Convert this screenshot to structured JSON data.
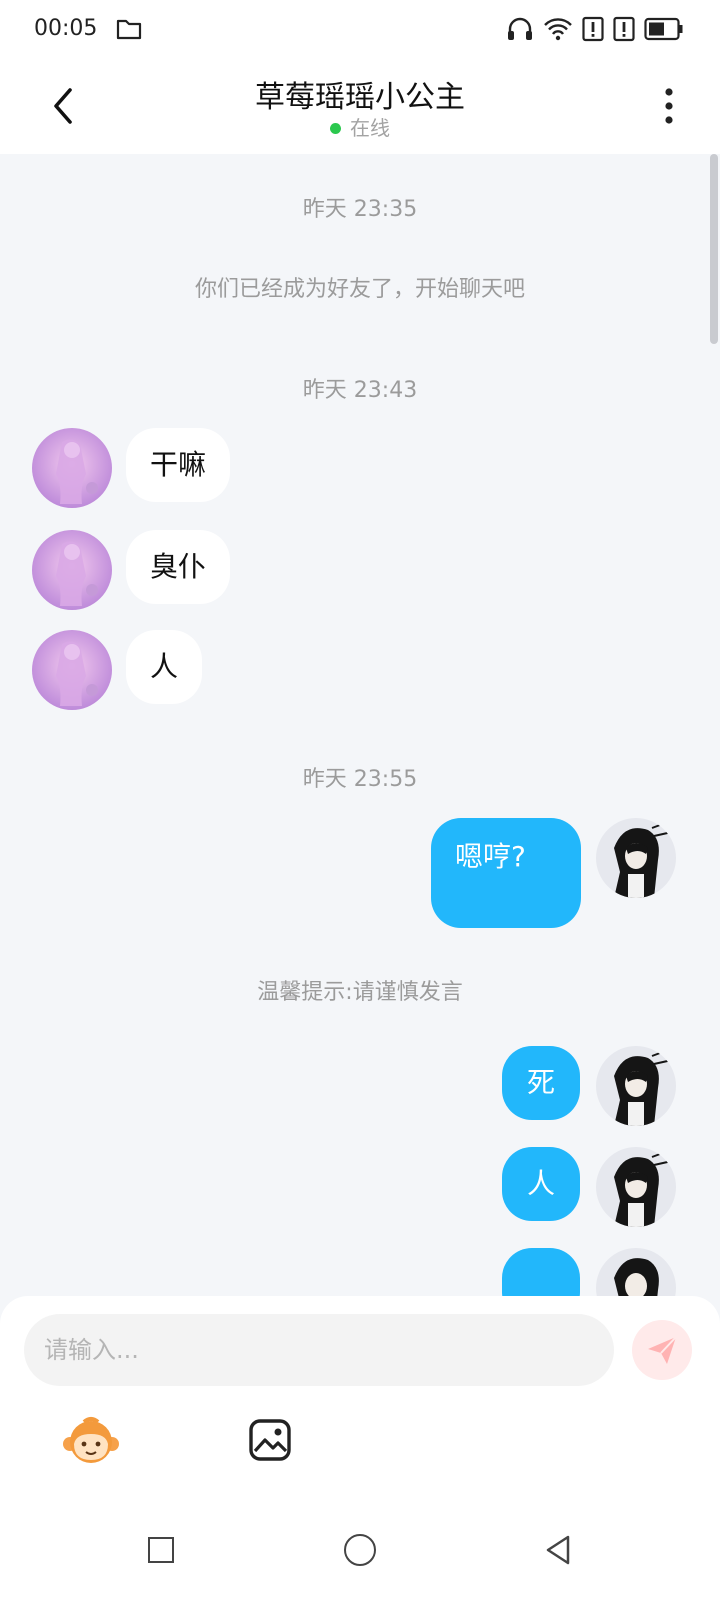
{
  "statusbar": {
    "time": "00:05",
    "icons": [
      "folder-icon",
      "headphones-icon",
      "wifi-icon",
      "alert-icon",
      "alert-icon",
      "battery-icon"
    ]
  },
  "header": {
    "title": "草莓瑶瑶小公主",
    "status": "在线",
    "status_color": "#2bc84e"
  },
  "chat": {
    "sections": [
      {
        "time": "昨天 23:35"
      },
      {
        "system": "你们已经成为好友了，开始聊天吧"
      },
      {
        "time": "昨天 23:43"
      },
      {
        "time": "昨天 23:55"
      },
      {
        "system": "温馨提示:请谨慎发言"
      }
    ],
    "incoming": [
      "干嘛",
      "臭仆",
      "人"
    ],
    "outgoing": [
      "嗯哼?",
      "死",
      "人"
    ]
  },
  "composer": {
    "placeholder": "请输入...",
    "accent": "#22b7fb"
  }
}
